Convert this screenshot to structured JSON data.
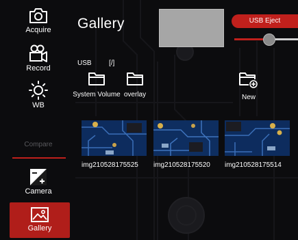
{
  "sidebar": {
    "acquire": "Acquire",
    "record": "Record",
    "wb": "WB",
    "compare": "Compare",
    "camera": "Camera",
    "gallery": "Gallery"
  },
  "header": {
    "title": "Gallery",
    "usb_eject": "USB Eject",
    "slider_level": 0.55
  },
  "path": {
    "device": "USB",
    "current": "[/]"
  },
  "folders": [
    {
      "label": "System Volume"
    },
    {
      "label": "overlay"
    },
    {
      "label": "New"
    }
  ],
  "images": [
    {
      "name": "img210528175525"
    },
    {
      "name": "img210528175520"
    },
    {
      "name": "img210528175514"
    }
  ],
  "colors": {
    "accent": "#c0201c",
    "background": "#0c0c0e",
    "preview": "#a6a6a6"
  }
}
